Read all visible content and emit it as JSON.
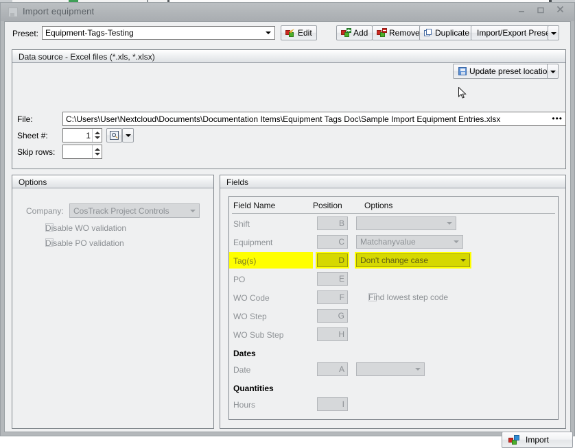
{
  "window": {
    "title": "Import equipment",
    "title_icon": "app-icon",
    "minimize": "–",
    "maximize": "☐",
    "close": "✕"
  },
  "preset": {
    "label": "Preset:",
    "value": "Equipment-Tags-Testing",
    "buttons": {
      "edit": "Edit",
      "add": "Add",
      "remove": "Remove",
      "duplicate": "Duplicate",
      "import_export": "Import/Export Preset"
    }
  },
  "data_source": {
    "title": "Data source - Excel files (*.xls, *.xlsx)",
    "update_preset_location": "Update preset location",
    "file_label": "File:",
    "file_value": "C:\\Users\\User\\Nextcloud\\Documents\\Documentation Items\\Equipment Tags Doc\\Sample Import Equipment Entries.xlsx",
    "file_browse_dots": "•••",
    "sheet_label": "Sheet #:",
    "sheet_value": "1",
    "skip_label": "Skip rows:",
    "skip_value": ""
  },
  "options": {
    "title": "Options",
    "company_label": "Company:",
    "company_value": "CosTrack Project Controls",
    "disable_wo": "Disable WO validation",
    "disable_po": "Disable PO validation"
  },
  "fields": {
    "title": "Fields",
    "columns": {
      "name": "Field Name",
      "position": "Position",
      "options": "Options"
    },
    "rows": [
      {
        "name": "Shift",
        "position": "B",
        "option_type": "combo",
        "option_value": "",
        "combo_width": 146,
        "highlight": false,
        "section": false
      },
      {
        "name": "Equipment",
        "position": "C",
        "option_type": "combo",
        "option_value": "Matchanyvalue",
        "combo_width": 156,
        "highlight": false,
        "section": false
      },
      {
        "name": "Tag(s)",
        "position": "D",
        "option_type": "combo",
        "option_value": "Don't change case",
        "combo_width": 166,
        "highlight": true,
        "section": false
      },
      {
        "name": "PO",
        "position": "E",
        "option_type": "none",
        "option_value": "",
        "combo_width": 0,
        "highlight": false,
        "section": false
      },
      {
        "name": "WO Code",
        "position": "F",
        "option_type": "checkbox",
        "option_value": "Find lowest step code",
        "combo_width": 0,
        "highlight": false,
        "section": false
      },
      {
        "name": "WO Step",
        "position": "G",
        "option_type": "none",
        "option_value": "",
        "combo_width": 0,
        "highlight": false,
        "section": false
      },
      {
        "name": "WO Sub Step",
        "position": "H",
        "option_type": "none",
        "option_value": "",
        "combo_width": 0,
        "highlight": false,
        "section": false
      },
      {
        "name": "Dates",
        "position": "",
        "option_type": "none",
        "option_value": "",
        "combo_width": 0,
        "highlight": false,
        "section": true
      },
      {
        "name": "Date",
        "position": "A",
        "option_type": "combo",
        "option_value": "",
        "combo_width": 100,
        "highlight": false,
        "section": false
      },
      {
        "name": "Quantities",
        "position": "",
        "option_type": "none",
        "option_value": "",
        "combo_width": 0,
        "highlight": false,
        "section": true
      },
      {
        "name": "Hours",
        "position": "I",
        "option_type": "none",
        "option_value": "",
        "combo_width": 0,
        "highlight": false,
        "section": false
      }
    ]
  },
  "footer": {
    "import": "Import"
  },
  "colors": {
    "highlight": "#ffff00",
    "window_chrome": "#b4b8bb",
    "client_background": "#eff0f1",
    "disabled_text": "#8d9195"
  }
}
